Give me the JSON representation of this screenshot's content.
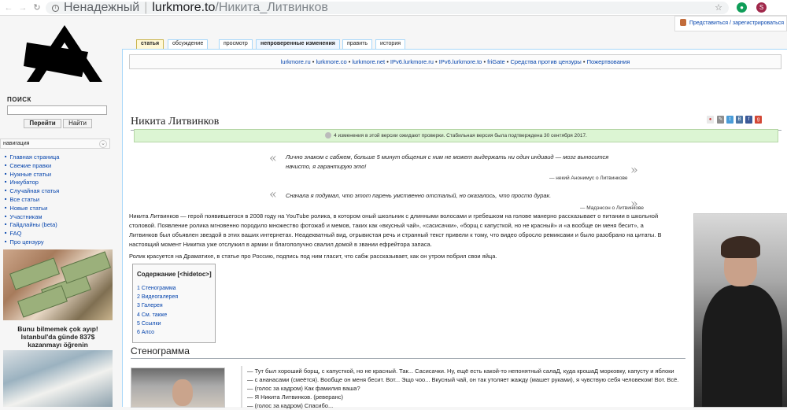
{
  "browser": {
    "insecure_label": "Ненадежный",
    "url_host": "lurkmore.to",
    "url_path": "/Никита_Литвинков",
    "profile_initial": "S"
  },
  "account": {
    "login_text": "Представиться / зарегистрироваться"
  },
  "sidebar": {
    "search_heading": "ПОИСК",
    "go_button": "Перейти",
    "find_button": "Найти",
    "nav_heading": "навигация",
    "nav_items": [
      "Главная страница",
      "Свежие правки",
      "Нужные статьи",
      "Инкубатор",
      "Случайная статья",
      "Все статьи",
      "Новые статьи",
      "Участникам",
      "Гайдлайны (beta)",
      "FAQ",
      "Про цензуру"
    ],
    "ad_text_line1": "Bunu bilmemek çok ayıp!",
    "ad_text_line2": "Istanbul'da günde 837$",
    "ad_text_line3": "kazanmayı öğrenin"
  },
  "tabs": [
    "статья",
    "обсуждение",
    "просмотр",
    "непроверенные изменения",
    "править",
    "история"
  ],
  "mirrors": {
    "links": [
      "lurkmore.ru",
      "lurkmore.co",
      "lurkmore.net",
      "IPv6.lurkmore.ru",
      "IPv6.lurkmore.to",
      "friGate",
      "Средства против цензуры",
      "Пожертвования"
    ],
    "separator": " • "
  },
  "article": {
    "title": "Никита Литвинков",
    "review_text": "4 изменения в этой версии ожидают проверки. Стабильная версия была подтверждена 30 сентября 2017.",
    "quote1_line1": "Лично знаком с сабжем, больше 5 минут общения с ним не может выдержать ни один индивид — мозг выносится",
    "quote1_line2": "начисто, я гарантирую это!",
    "quote1_attr": "— некий Анонимус о Литвинкове",
    "quote2_text": "Сначала я подумал, что этот парень умственно отсталый, но оказалось, что просто дурак.",
    "quote2_attr": "— Мадэнсон о Литвинкове",
    "intro_line1": "Никита Литвинков — герой появившегося в 2008 году на YouTube ролика, в котором оный школьник с длинными волосами и гребешком на голове манерно рассказывает о питании в школьной",
    "intro_line2": "столовой. Появление ролика мгновенно породило множество фотожаб и мемов, таких как «вкусный чай», «сасисачки», «борщ с капусткой, но не красный» и «а вообще он меня бесит», а",
    "intro_line3": "Литвинков был объявлен звездой в этих ваших интернетах. Неадекватный вид, отрывистая речь и странный текст привели к тому, что видео обросло ремиксами и было разобрано на цитаты. В",
    "intro_line4": "настоящий момент Никитка уже отслужил в армии и благополучно свалил домой в звании ефрейтора запаса.",
    "para2": "Ролик красуется на Драматихе, в статье про Россию, подпись под ним гласит, что сабж рассказывает, как он утром побрил свои яйца.",
    "toc_title": "Содержание [<hidetoc>]",
    "toc": [
      "1 Стенограмма",
      "2 Видеогалерея",
      "3 Галерея",
      "4 См. также",
      "5 Ссылки",
      "6 Алсо"
    ],
    "section_title": "Стенограмма",
    "dialog": [
      "Тут был хороший борщ, с капусткой, но не красный. Так... Сасисачки. Ну, ещё есть какой-то непонятный салаД, куда крошаД морковку, капусту и яблоки",
      "с ананасами (смеётся). Вообще он меня бесит. Вот... Эщо чоо... Вкусный чай, он так утоляет жажду (машет руками), я чувствую себя человеком! Вот. Всё.",
      "(голос за кадром) Как фамилия ваша?",
      "Я Никита Литвинков. (реверанс)",
      "(голос за кадром) Спасибо..."
    ]
  },
  "colors": {
    "link": "#0645ad",
    "tab_border": "#a7d7f9",
    "review_bg": "#dcf5d3"
  }
}
